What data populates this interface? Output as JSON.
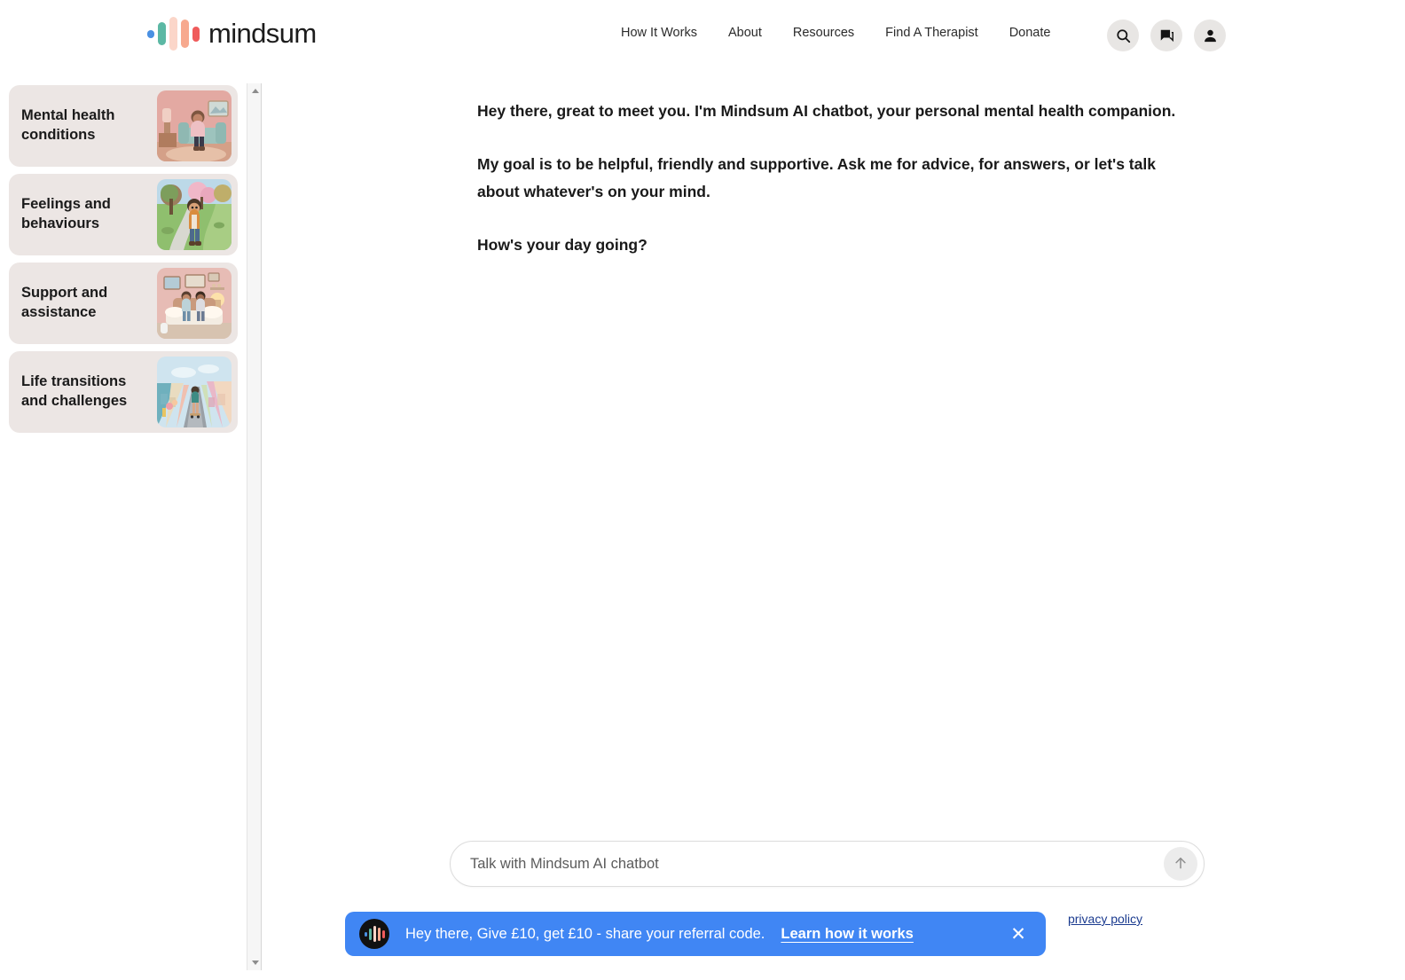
{
  "header": {
    "logo_text": "mindsum",
    "logo_icon": "mindsum-waveform-logo",
    "nav": [
      {
        "label": "How It Works"
      },
      {
        "label": "About"
      },
      {
        "label": "Resources"
      },
      {
        "label": "Find A Therapist"
      },
      {
        "label": "Donate"
      }
    ],
    "icons": [
      {
        "name": "search-icon"
      },
      {
        "name": "chat-bubbles-icon"
      },
      {
        "name": "user-account-icon"
      }
    ]
  },
  "sidebar": {
    "topics": [
      {
        "label": "Mental health conditions",
        "thumb": "girl-sitting-on-couch-pink-room"
      },
      {
        "label": "Feelings and behaviours",
        "thumb": "boy-standing-on-park-path"
      },
      {
        "label": "Support and assistance",
        "thumb": "two-people-sitting-on-bed"
      },
      {
        "label": "Life transitions and challenges",
        "thumb": "person-skateboarding-on-colorful-street"
      }
    ],
    "scrollbar": {
      "up_arrow": "scroll-up-arrow",
      "down_arrow": "scroll-down-arrow"
    }
  },
  "chat": {
    "message_paragraphs": [
      "Hey there, great to meet you. I'm Mindsum AI chatbot, your personal mental health companion.",
      " My goal is to be helpful, friendly and supportive. Ask me for advice, for answers, or let's talk about whatever's on your mind.",
      "How's your day going?"
    ],
    "composer": {
      "placeholder": "Talk with Mindsum AI chatbot",
      "value": "",
      "send_icon": "send-arrow-up-icon"
    },
    "policy_text": "privacy policy"
  },
  "banner": {
    "avatar_icon": "mindsum-waveform-avatar",
    "text": "Hey there, Give £10, get £10 - share your referral code.",
    "link_label": "Learn how it works",
    "close_icon": "close-x-icon",
    "background_color": "#4086f4"
  },
  "colors": {
    "card_background": "#ece6e4",
    "banner_blue": "#4086f4",
    "logo_blue": "#4a90e2",
    "logo_teal": "#5cb8a4",
    "logo_peach_light": "#fbd6c9",
    "logo_peach": "#f7a98e",
    "logo_red": "#ef5b5b"
  }
}
